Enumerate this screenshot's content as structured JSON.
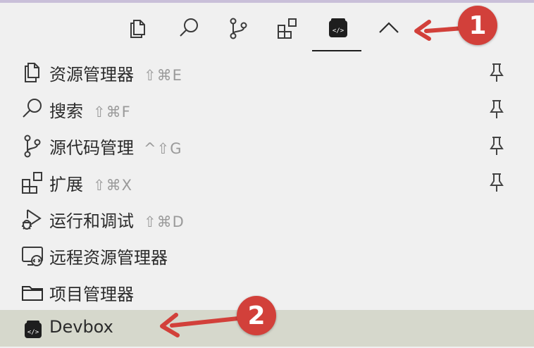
{
  "toolbar": {
    "icons": [
      "copy-icon",
      "search-icon",
      "source-control-icon",
      "extensions-icon",
      "devbox-icon",
      "chevron-up-icon"
    ]
  },
  "menu": {
    "items": [
      {
        "label": "资源管理器",
        "shortcut": "⇧⌘E",
        "icon": "copy-icon",
        "pinned": true
      },
      {
        "label": "搜索",
        "shortcut": "⇧⌘F",
        "icon": "search-icon",
        "pinned": true
      },
      {
        "label": "源代码管理",
        "shortcut": "^⇧G",
        "icon": "source-control-icon",
        "pinned": true
      },
      {
        "label": "扩展",
        "shortcut": "⇧⌘X",
        "icon": "extensions-icon",
        "pinned": true
      },
      {
        "label": "运行和调试",
        "shortcut": "⇧⌘D",
        "icon": "run-debug-icon",
        "pinned": false
      },
      {
        "label": "远程资源管理器",
        "shortcut": "",
        "icon": "remote-explorer-icon",
        "pinned": false
      },
      {
        "label": "项目管理器",
        "shortcut": "",
        "icon": "folder-icon",
        "pinned": false
      },
      {
        "label": "Devbox",
        "shortcut": "",
        "icon": "devbox-icon",
        "pinned": false
      }
    ]
  },
  "annotations": {
    "badge1": "1",
    "badge2": "2",
    "color": "#d2403a"
  }
}
